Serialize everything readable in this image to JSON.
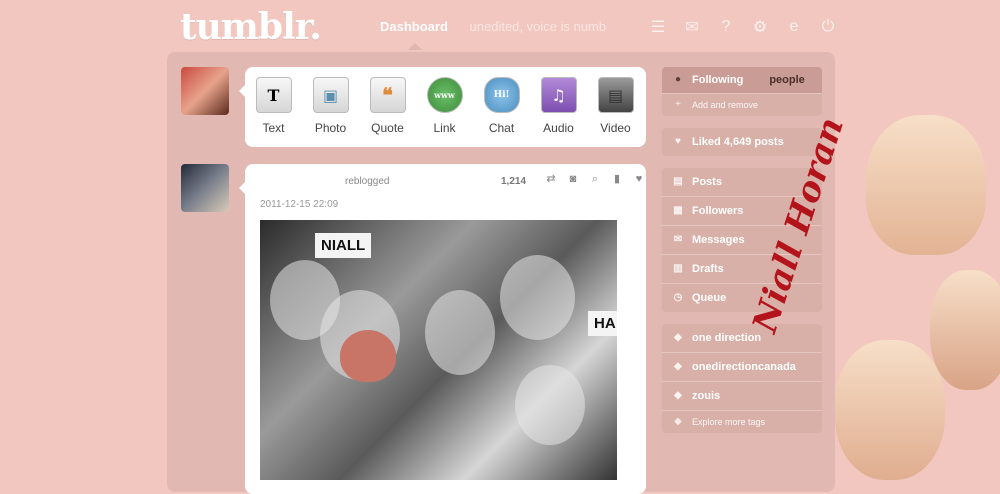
{
  "header": {
    "logo": "tumblr.",
    "nav_dashboard": "Dashboard",
    "nav_blog": "unedited, voice is numb"
  },
  "top_icons": [
    "list-icon",
    "mail-icon",
    "help-icon",
    "gear-icon",
    "account-icon",
    "power-icon"
  ],
  "post_types": [
    {
      "label": "Text",
      "icon": "T"
    },
    {
      "label": "Photo",
      "icon": "▣"
    },
    {
      "label": "Quote",
      "icon": "❝"
    },
    {
      "label": "Link",
      "icon": "www"
    },
    {
      "label": "Chat",
      "icon": "Hi!"
    },
    {
      "label": "Audio",
      "icon": "♫"
    },
    {
      "label": "Video",
      "icon": "▤"
    }
  ],
  "post": {
    "action": "reblogged",
    "notes": "1,214",
    "date": "2011-12-15 22:09",
    "photo_sign1": "NIALL",
    "photo_sign2": "HA"
  },
  "sidebar": {
    "following_label": "Following",
    "following_suffix": "people",
    "add_remove": "Add and remove",
    "liked": "Liked 4,649 posts",
    "menu": [
      "Posts",
      "Followers",
      "Messages",
      "Drafts",
      "Queue"
    ],
    "tags": [
      "one direction",
      "onedirectioncanada",
      "zouis"
    ],
    "explore": "Explore more tags"
  },
  "right_art": {
    "signature": "Niall Horan"
  },
  "colors": {
    "background": "#f2c7bf",
    "container": "#e2b9b2",
    "sidebar_box": "#d9b0a8"
  }
}
